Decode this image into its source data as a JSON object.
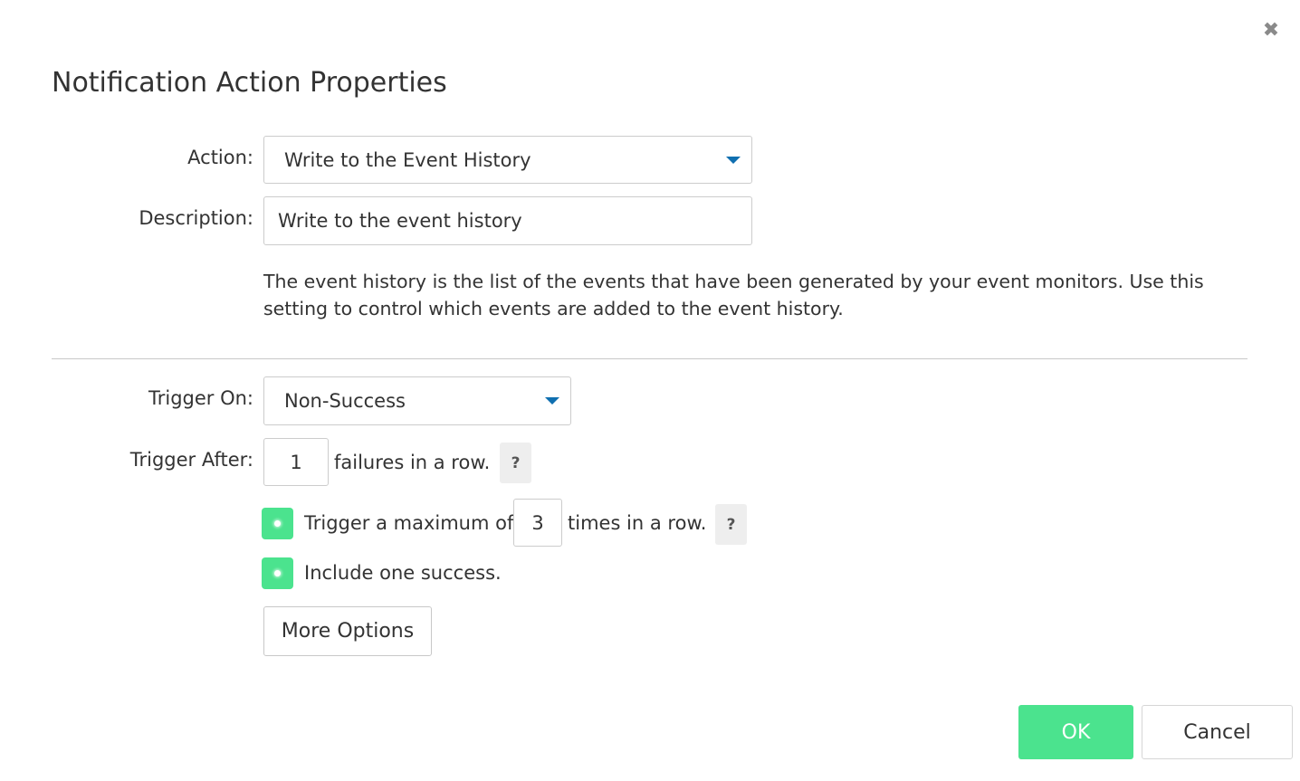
{
  "dialog": {
    "title": "Notification Action Properties",
    "close_icon": "close-icon"
  },
  "form": {
    "action_label": "Action:",
    "action_value": "Write to the Event History",
    "description_label": "Description:",
    "description_value": "Write to the event history",
    "help_text": "The event history is the list of the events that have been generated by your event monitors. Use this setting to control which events are added to the event history.",
    "trigger_on_label": "Trigger On:",
    "trigger_on_value": "Non-Success",
    "trigger_after_label": "Trigger After:",
    "trigger_after_value": "1",
    "trigger_after_suffix": "failures in a row.",
    "help_symbol": "?",
    "max_trigger_prefix": "Trigger a maximum of",
    "max_trigger_value": "3",
    "max_trigger_suffix": "times in a row.",
    "include_success_label": "Include one success.",
    "more_options_label": "More Options"
  },
  "footer": {
    "ok_label": "OK",
    "cancel_label": "Cancel"
  },
  "colors": {
    "accent_green": "#4be38e",
    "caret_blue": "#0f6fb0"
  }
}
